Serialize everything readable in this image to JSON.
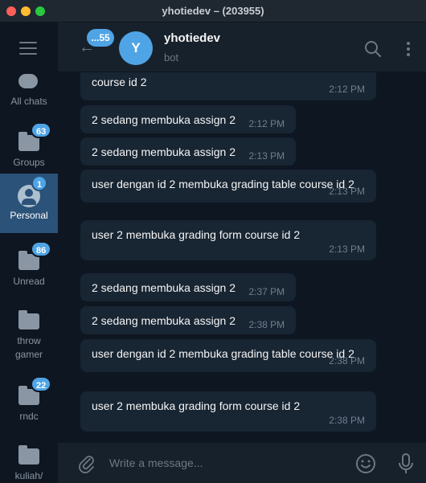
{
  "window": {
    "title": "yhotiedev – (203955)"
  },
  "sidebar": {
    "menu_icon": "hamburger-icon",
    "folders": [
      {
        "label": "All chats",
        "badge": "",
        "icon": "chat-bubble-icon"
      },
      {
        "label": "Groups",
        "badge": "63",
        "icon": "folder-icon"
      },
      {
        "label": "Personal",
        "badge": "1",
        "icon": "person-icon",
        "active": true
      },
      {
        "label": "Unread",
        "badge": "86",
        "icon": "folder-icon"
      },
      {
        "label": "throw gamer",
        "badge": "",
        "icon": "folder-icon"
      },
      {
        "label": "rndc",
        "badge": "22",
        "icon": "folder-icon"
      },
      {
        "label": "kuliah/",
        "badge": "",
        "icon": "folder-icon"
      }
    ]
  },
  "header": {
    "back_badge": "...55",
    "avatar_letter": "Y",
    "name": "yhotiedev",
    "status": "bot"
  },
  "messages": [
    {
      "text": "course id 2",
      "time": "2:12 PM"
    },
    {
      "text": "2 sedang membuka assign 2",
      "time": "2:12 PM"
    },
    {
      "text": "2 sedang membuka assign 2",
      "time": "2:13 PM"
    },
    {
      "text": "user dengan id 2 membuka grading table course id 2",
      "time": "2:13 PM"
    },
    {
      "text": "user 2 membuka grading form course id 2",
      "time": "2:13 PM"
    },
    {
      "text": "2 sedang membuka assign 2",
      "time": "2:37 PM"
    },
    {
      "text": "2 sedang membuka assign 2",
      "time": "2:38 PM"
    },
    {
      "text": "user dengan id 2 membuka grading table course id 2",
      "time": "2:38 PM"
    },
    {
      "text": "user 2 membuka grading form course id 2",
      "time": "2:38 PM"
    }
  ],
  "composer": {
    "placeholder": "Write a message..."
  },
  "colors": {
    "accent": "#4fa4e5",
    "sidebar_bg": "#0e1621",
    "bubble_bg": "#182533",
    "active_folder": "#2b5278"
  }
}
